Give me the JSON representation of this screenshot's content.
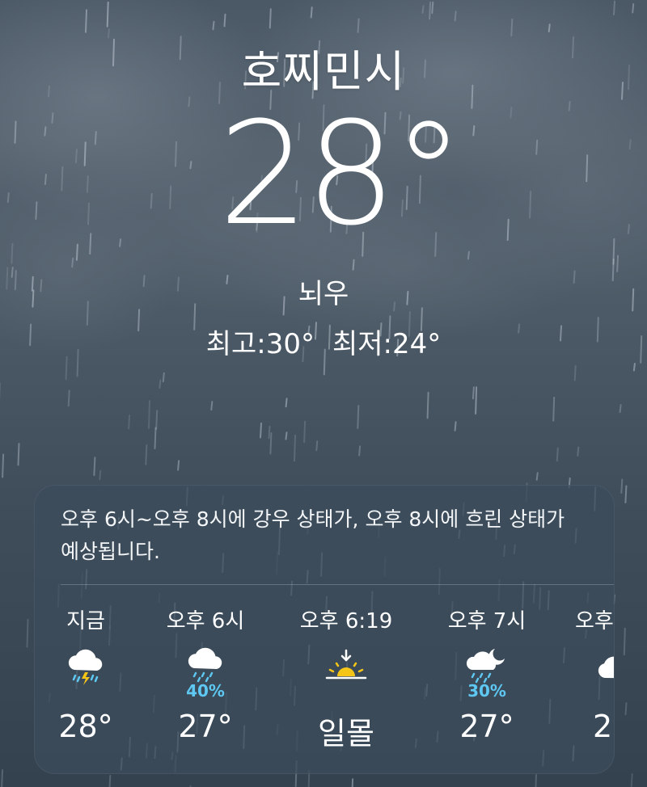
{
  "location": {
    "city": "호찌민시",
    "temperature": "28°",
    "condition": "뇌우",
    "high": "최고:30°",
    "low": "최저:24°"
  },
  "forecast": {
    "summary": "오후 6시~오후 8시에 강우 상태가, 오후 8시에 흐린 상태가 예상됩니다.",
    "hours": [
      {
        "time": "지금",
        "icon": "cloud-bolt-rain-icon",
        "pop": "",
        "value": "28°"
      },
      {
        "time": "오후 6시",
        "icon": "cloud-rain-icon",
        "pop": "40%",
        "value": "27°"
      },
      {
        "time": "오후 6:19",
        "icon": "sunset-icon",
        "pop": "",
        "value": "일몰"
      },
      {
        "time": "오후 7시",
        "icon": "cloud-moon-rain-icon",
        "pop": "30%",
        "value": "27°"
      },
      {
        "time": "오후",
        "icon": "cloud-icon",
        "pop": "",
        "value": "2"
      }
    ]
  },
  "colors": {
    "precip": "#5ec8f2",
    "sun": "#f5c518",
    "card": "#3c4c5c"
  }
}
